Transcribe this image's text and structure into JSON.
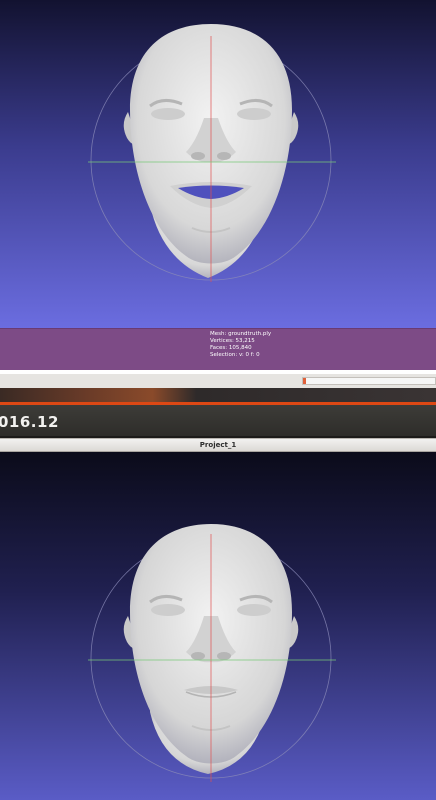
{
  "window": {
    "title_fragment": "016.12",
    "project_tab": "Project_1"
  },
  "info_panel": {
    "mesh": "Mesh: groundtruth.ply",
    "vertices": "Vertices: 53,215",
    "faces": "Faces: 105,840",
    "selection": "Selection: v: 0 f: 0"
  },
  "progress": {
    "value_fraction": 0.02
  },
  "colors": {
    "viewport_top": "#121230",
    "viewport_bottom": "#6b6de0",
    "info_panel": "#7d4b86",
    "ubuntu_orange": "#dd4814",
    "axis_red": "#e05050",
    "axis_green": "#78c878",
    "trackball": "#8a8ab8",
    "face": "#e2e2e2"
  },
  "icons": {
    "top_face": "face-mesh-open-mouth",
    "bottom_face": "face-mesh-closed-mouth",
    "trackball": "trackball-gizmo"
  }
}
